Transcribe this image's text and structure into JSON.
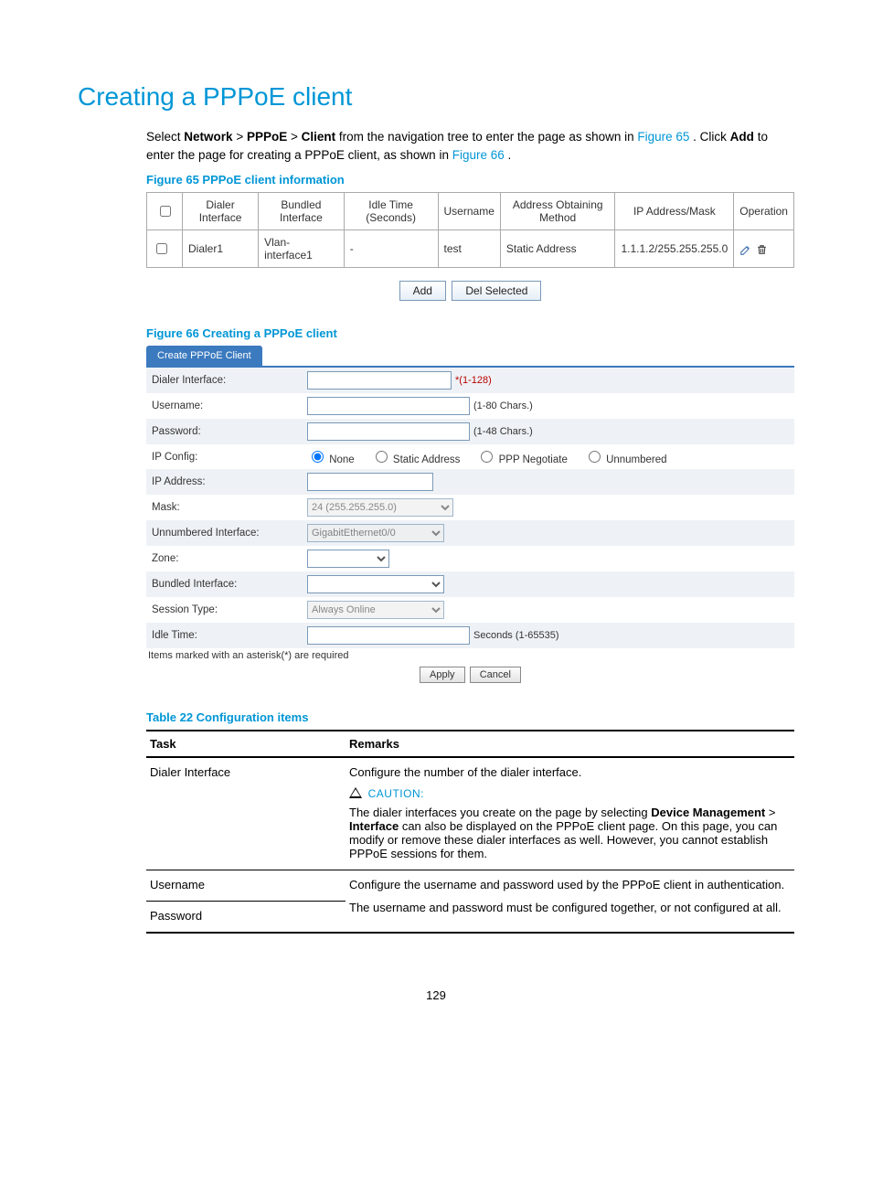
{
  "title": "Creating a PPPoE client",
  "intro": {
    "p1_a": "Select ",
    "nav1": "Network",
    "gt": " > ",
    "nav2": "PPPoE",
    "nav3": "Client",
    "p1_b": " from the navigation tree to enter the page as shown in ",
    "fig65link": "Figure 65",
    "p1_c": ". Click ",
    "add_bold": "Add",
    "p1_d": " to enter the page for creating a PPPoE client, as shown in ",
    "fig66link": "Figure 66",
    "p1_e": "."
  },
  "fig65": {
    "caption": "Figure 65 PPPoE client information",
    "headers": {
      "c1": "Dialer Interface",
      "c2": "Bundled Interface",
      "c3": "Idle Time (Seconds)",
      "c4": "Username",
      "c5": "Address Obtaining Method",
      "c6": "IP Address/Mask",
      "c7": "Operation"
    },
    "row": {
      "dialer": "Dialer1",
      "bundled": "Vlan-interface1",
      "idle": "-",
      "user": "test",
      "method": "Static Address",
      "ipmask": "1.1.1.2/255.255.255.0"
    },
    "buttons": {
      "add": "Add",
      "del": "Del Selected"
    }
  },
  "fig66": {
    "caption": "Figure 66 Creating a PPPoE client",
    "tab": "Create PPPoE Client",
    "labels": {
      "dialer": "Dialer Interface:",
      "username": "Username:",
      "password": "Password:",
      "ipconfig": "IP Config:",
      "ipaddr": "IP Address:",
      "mask": "Mask:",
      "unnum": "Unnumbered Interface:",
      "zone": "Zone:",
      "bundled": "Bundled Interface:",
      "session": "Session Type:",
      "idle": "Idle Time:"
    },
    "hints": {
      "dialer": "*(1-128)",
      "username": "(1-80 Chars.)",
      "password": "(1-48 Chars.)",
      "idle": "Seconds (1-65535)"
    },
    "radios": {
      "none": "None",
      "static": "Static Address",
      "ppp": "PPP Negotiate",
      "unnum": "Unnumbered"
    },
    "selects": {
      "mask": "24 (255.255.255.0)",
      "unnum": "GigabitEthernet0/0",
      "session": "Always Online"
    },
    "note": "Items marked with an asterisk(*) are required",
    "apply": "Apply",
    "cancel": "Cancel"
  },
  "table22": {
    "caption": "Table 22 Configuration items",
    "head": {
      "task": "Task",
      "remarks": "Remarks"
    },
    "rows": {
      "r1": {
        "task": "Dialer Interface",
        "line1": "Configure the number of the dialer interface.",
        "caution_label": "CAUTION:",
        "body_a": "The dialer interfaces you create on the page by selecting ",
        "bold1": "Device Management",
        "gt": " > ",
        "bold2": "Interface",
        "body_b": " can also be displayed on the PPPoE client page. On this page, you can modify or remove these dialer interfaces as well. However, you cannot establish PPPoE sessions for them."
      },
      "r2": {
        "task": "Username",
        "text": "Configure the username and password used by the PPPoE client in authentication."
      },
      "r3": {
        "task": "Password",
        "text": "The username and password must be configured together, or not configured at all."
      }
    }
  },
  "page_number": "129"
}
